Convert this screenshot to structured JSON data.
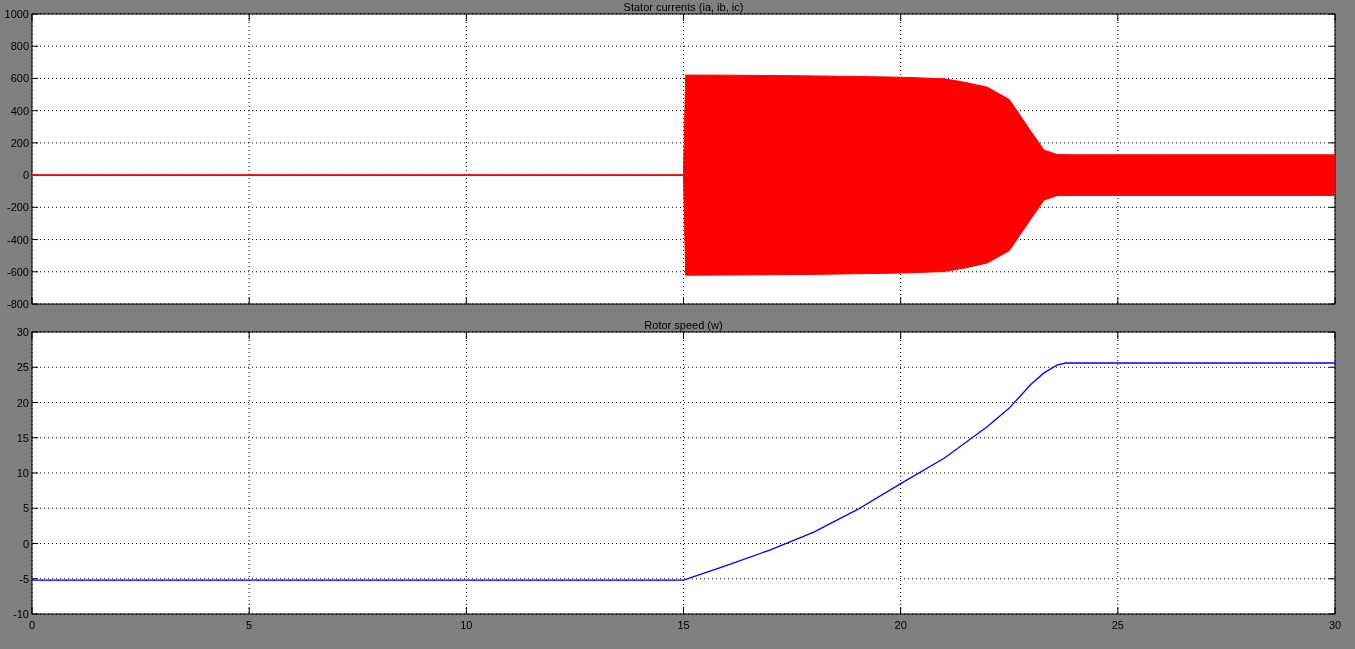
{
  "charts": [
    {
      "chart_data": {
        "type": "area",
        "title": "Stator currents (ia, ib, ic)",
        "x": [
          0,
          15,
          15.05,
          16,
          17,
          18,
          19,
          20,
          21,
          21.5,
          22,
          22.5,
          23,
          23.3,
          23.6,
          24,
          26,
          28,
          30
        ],
        "series": [
          {
            "color": "#ff0000",
            "values": [
              0,
              0,
              621,
              620,
              618,
              616,
              612,
              608,
              598,
              575,
              545,
              469,
              271,
              155,
              128,
              126,
              126,
              126,
              126
            ]
          },
          {
            "color": "#ff0000",
            "values": [
              0,
              0,
              -621,
              -620,
              -618,
              -616,
              -612,
              -608,
              -598,
              -575,
              -545,
              -469,
              -271,
              -155,
              -128,
              -126,
              -126,
              -126,
              -126
            ]
          }
        ],
        "xlim": [
          0,
          30
        ],
        "ylim": [
          -800,
          1000
        ],
        "yticks": [
          -800,
          -600,
          -400,
          -200,
          0,
          200,
          400,
          600,
          800,
          1000
        ],
        "grid": true
      }
    },
    {
      "chart_data": {
        "type": "line",
        "title": "Rotor speed (w)",
        "x": [
          0,
          15,
          16,
          17,
          18,
          19,
          20,
          21,
          22,
          22.5,
          23,
          23.3,
          23.6,
          23.8,
          24,
          30
        ],
        "series": [
          {
            "color": "#0000ff",
            "values": [
              -5.2,
              -5.2,
              -3.1,
              -0.9,
              1.6,
              4.8,
              8.5,
              12.1,
              16.6,
              19.2,
              22.6,
              24.2,
              25.3,
              25.6,
              25.6,
              25.6
            ]
          }
        ],
        "xlim": [
          0,
          30
        ],
        "ylim": [
          -10,
          30
        ],
        "xticks": [
          0,
          5,
          10,
          15,
          20,
          25,
          30
        ],
        "yticks": [
          -10,
          -5,
          0,
          5,
          10,
          15,
          20,
          25,
          30
        ],
        "grid": true
      }
    }
  ]
}
